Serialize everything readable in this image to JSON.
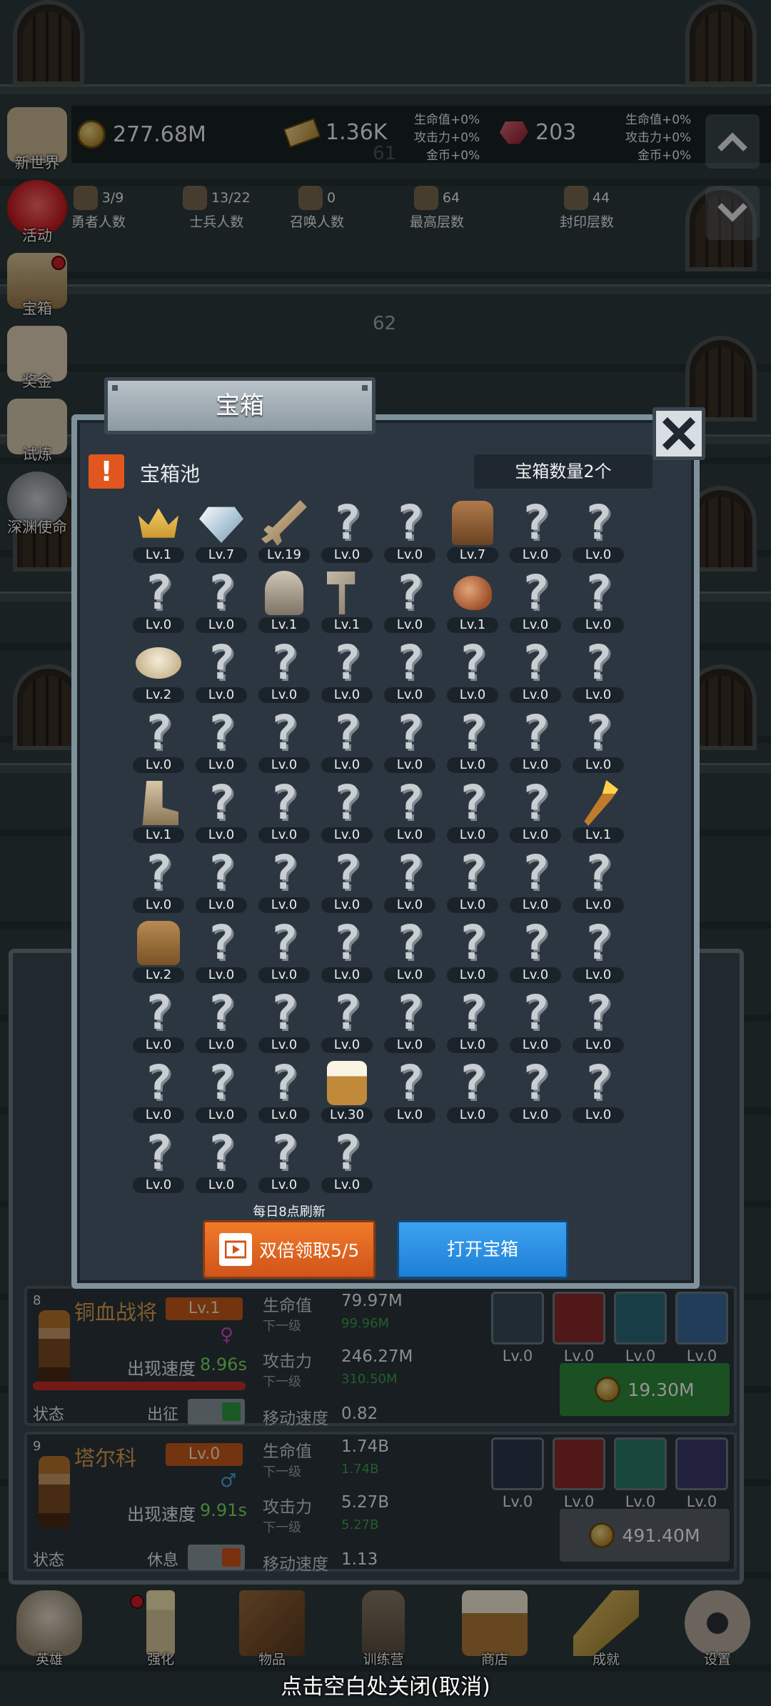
{
  "top": {
    "gold": "277.68M",
    "bars": "1.36K",
    "gems": "203",
    "bonus_left": [
      "生命值+0%",
      "攻击力+0%",
      "金币+0%"
    ],
    "bonus_right": [
      "生命值+0%",
      "攻击力+0%",
      "金币+0%"
    ],
    "floor_labels": [
      "61",
      "62"
    ],
    "stats": [
      {
        "value": "3/9",
        "label": "勇者人数",
        "icon": "hero-icon"
      },
      {
        "value": "13/22",
        "label": "士兵人数",
        "icon": "soldier-icon"
      },
      {
        "value": "0",
        "label": "召唤人数",
        "icon": "summon-icon"
      },
      {
        "value": "64",
        "label": "最高层数",
        "icon": "stone-icon"
      },
      {
        "value": "44",
        "label": "封印层数",
        "icon": "scroll-icon"
      }
    ]
  },
  "side_menu": [
    "新世界",
    "活动",
    "宝箱",
    "奖金",
    "试炼",
    "深渊使命"
  ],
  "modal": {
    "tab_title": "宝箱",
    "pool_title": "宝箱池",
    "count_text": "宝箱数量2个",
    "refresh_note": "每日8点刷新",
    "double_label": "双倍领取5/5",
    "open_label": "打开宝箱",
    "items": [
      {
        "icon": "crown-icon",
        "lv": "Lv.1"
      },
      {
        "icon": "diamond-icon",
        "lv": "Lv.7"
      },
      {
        "icon": "sword-icon",
        "lv": "Lv.19"
      },
      {
        "icon": "unknown-icon",
        "lv": "Lv.0"
      },
      {
        "icon": "unknown-icon",
        "lv": "Lv.0"
      },
      {
        "icon": "armor-icon",
        "lv": "Lv.7"
      },
      {
        "icon": "unknown-icon",
        "lv": "Lv.0"
      },
      {
        "icon": "unknown-icon",
        "lv": "Lv.0"
      },
      {
        "icon": "unknown-icon",
        "lv": "Lv.0"
      },
      {
        "icon": "unknown-icon",
        "lv": "Lv.0"
      },
      {
        "icon": "helmet-icon",
        "lv": "Lv.1"
      },
      {
        "icon": "hammer-icon",
        "lv": "Lv.1"
      },
      {
        "icon": "unknown-icon",
        "lv": "Lv.0"
      },
      {
        "icon": "meat-icon",
        "lv": "Lv.1"
      },
      {
        "icon": "unknown-icon",
        "lv": "Lv.0"
      },
      {
        "icon": "unknown-icon",
        "lv": "Lv.0"
      },
      {
        "icon": "bread-icon",
        "lv": "Lv.2"
      },
      {
        "icon": "unknown-icon",
        "lv": "Lv.0"
      },
      {
        "icon": "unknown-icon",
        "lv": "Lv.0"
      },
      {
        "icon": "unknown-icon",
        "lv": "Lv.0"
      },
      {
        "icon": "unknown-icon",
        "lv": "Lv.0"
      },
      {
        "icon": "unknown-icon",
        "lv": "Lv.0"
      },
      {
        "icon": "unknown-icon",
        "lv": "Lv.0"
      },
      {
        "icon": "unknown-icon",
        "lv": "Lv.0"
      },
      {
        "icon": "unknown-icon",
        "lv": "Lv.0"
      },
      {
        "icon": "unknown-icon",
        "lv": "Lv.0"
      },
      {
        "icon": "unknown-icon",
        "lv": "Lv.0"
      },
      {
        "icon": "unknown-icon",
        "lv": "Lv.0"
      },
      {
        "icon": "unknown-icon",
        "lv": "Lv.0"
      },
      {
        "icon": "unknown-icon",
        "lv": "Lv.0"
      },
      {
        "icon": "unknown-icon",
        "lv": "Lv.0"
      },
      {
        "icon": "unknown-icon",
        "lv": "Lv.0"
      },
      {
        "icon": "boot-icon",
        "lv": "Lv.1"
      },
      {
        "icon": "unknown-icon",
        "lv": "Lv.0"
      },
      {
        "icon": "unknown-icon",
        "lv": "Lv.0"
      },
      {
        "icon": "unknown-icon",
        "lv": "Lv.0"
      },
      {
        "icon": "unknown-icon",
        "lv": "Lv.0"
      },
      {
        "icon": "unknown-icon",
        "lv": "Lv.0"
      },
      {
        "icon": "unknown-icon",
        "lv": "Lv.0"
      },
      {
        "icon": "torch-icon",
        "lv": "Lv.1"
      },
      {
        "icon": "unknown-icon",
        "lv": "Lv.0"
      },
      {
        "icon": "unknown-icon",
        "lv": "Lv.0"
      },
      {
        "icon": "unknown-icon",
        "lv": "Lv.0"
      },
      {
        "icon": "unknown-icon",
        "lv": "Lv.0"
      },
      {
        "icon": "unknown-icon",
        "lv": "Lv.0"
      },
      {
        "icon": "unknown-icon",
        "lv": "Lv.0"
      },
      {
        "icon": "unknown-icon",
        "lv": "Lv.0"
      },
      {
        "icon": "unknown-icon",
        "lv": "Lv.0"
      },
      {
        "icon": "backpack-icon",
        "lv": "Lv.2"
      },
      {
        "icon": "unknown-icon",
        "lv": "Lv.0"
      },
      {
        "icon": "unknown-icon",
        "lv": "Lv.0"
      },
      {
        "icon": "unknown-icon",
        "lv": "Lv.0"
      },
      {
        "icon": "unknown-icon",
        "lv": "Lv.0"
      },
      {
        "icon": "unknown-icon",
        "lv": "Lv.0"
      },
      {
        "icon": "unknown-icon",
        "lv": "Lv.0"
      },
      {
        "icon": "unknown-icon",
        "lv": "Lv.0"
      },
      {
        "icon": "unknown-icon",
        "lv": "Lv.0"
      },
      {
        "icon": "unknown-icon",
        "lv": "Lv.0"
      },
      {
        "icon": "unknown-icon",
        "lv": "Lv.0"
      },
      {
        "icon": "unknown-icon",
        "lv": "Lv.0"
      },
      {
        "icon": "unknown-icon",
        "lv": "Lv.0"
      },
      {
        "icon": "unknown-icon",
        "lv": "Lv.0"
      },
      {
        "icon": "unknown-icon",
        "lv": "Lv.0"
      },
      {
        "icon": "unknown-icon",
        "lv": "Lv.0"
      },
      {
        "icon": "unknown-icon",
        "lv": "Lv.0"
      },
      {
        "icon": "unknown-icon",
        "lv": "Lv.0"
      },
      {
        "icon": "unknown-icon",
        "lv": "Lv.0"
      },
      {
        "icon": "beer-icon",
        "lv": "Lv.30"
      },
      {
        "icon": "unknown-icon",
        "lv": "Lv.0"
      },
      {
        "icon": "unknown-icon",
        "lv": "Lv.0"
      },
      {
        "icon": "unknown-icon",
        "lv": "Lv.0"
      },
      {
        "icon": "unknown-icon",
        "lv": "Lv.0"
      },
      {
        "icon": "unknown-icon",
        "lv": "Lv.0"
      },
      {
        "icon": "unknown-icon",
        "lv": "Lv.0"
      },
      {
        "icon": "unknown-icon",
        "lv": "Lv.0"
      },
      {
        "icon": "unknown-icon",
        "lv": "Lv.0"
      }
    ]
  },
  "heroes": [
    {
      "num": "8",
      "name": "铜血战将",
      "lv": "Lv.1",
      "gender": "♀",
      "gender_color": "#d04ac8",
      "speed_label": "出现速度",
      "speed": "8.96s",
      "state_label": "状态",
      "action": "出征",
      "hp_label": "生命值",
      "hp": "79.97M",
      "next_label": "下一级",
      "hp_next": "99.96M",
      "atk_label": "攻击力",
      "atk": "246.27M",
      "atk_next": "310.50M",
      "move_label": "移动速度",
      "move": "0.82",
      "skills": [
        "Lv.0",
        "Lv.0",
        "Lv.0",
        "Lv.0"
      ],
      "cost": "19.30M",
      "cost_color": "#2f8a3c"
    },
    {
      "num": "9",
      "name": "塔尔科",
      "lv": "Lv.0",
      "gender": "♂",
      "gender_color": "#4aa8e0",
      "speed_label": "出现速度",
      "speed": "9.91s",
      "state_label": "状态",
      "action": "休息",
      "hp_label": "生命值",
      "hp": "1.74B",
      "next_label": "下一级",
      "hp_next": "1.74B",
      "atk_label": "攻击力",
      "atk": "5.27B",
      "atk_next": "5.27B",
      "move_label": "移动速度",
      "move": "1.13",
      "skills": [
        "Lv.0",
        "Lv.0",
        "Lv.0",
        "Lv.0"
      ],
      "cost": "491.40M",
      "cost_color": "#5a6066"
    }
  ],
  "nav": [
    "英雄",
    "强化",
    "物品",
    "训练营",
    "商店",
    "成就",
    "设置"
  ],
  "close_hint": "点击空白处关闭(取消)"
}
